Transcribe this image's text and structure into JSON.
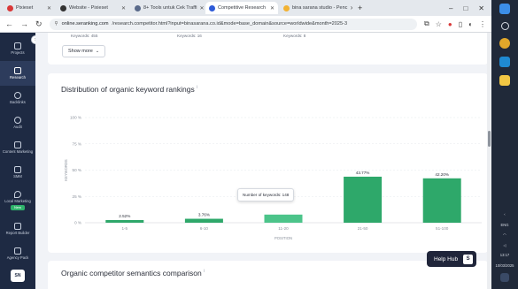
{
  "browser": {
    "tabs": [
      {
        "label": "Pixieset",
        "color": "#d93838",
        "active": false
      },
      {
        "label": "Website - Pixieset",
        "color": "#333333",
        "active": false
      },
      {
        "label": "8+ Tools untuk Cek Traffi",
        "color": "#5a6a8a",
        "active": false
      },
      {
        "label": "Competitive Research",
        "color": "#2e5bd8",
        "active": true
      },
      {
        "label": "bina sarana studio - Penc",
        "color": "#f2b233",
        "active": false
      }
    ],
    "new_tab": "+",
    "window_controls": {
      "minimize": "–",
      "maximize": "□",
      "close": "✕"
    },
    "url_host": "online.seranking.com",
    "url_path": "/research.competitor.html?input=binasarana.co.id&mode=base_domain&source=worldwide&month=2025-3"
  },
  "leftnav": {
    "items": [
      {
        "label": "Projects",
        "active": false
      },
      {
        "label": "Research",
        "active": true
      },
      {
        "label": "Backlinks",
        "active": false
      },
      {
        "label": "Audit",
        "active": false
      },
      {
        "label": "Content Marketing",
        "active": false
      },
      {
        "label": "SMM",
        "active": false
      },
      {
        "label": "Local Marketing",
        "active": false,
        "badge": "New"
      },
      {
        "label": "Report Builder",
        "active": false
      },
      {
        "label": "Agency Pack",
        "active": false
      }
    ],
    "user_initials": "SN"
  },
  "top_card": {
    "keywords": [
      "Keywords: 455",
      "Keywords: 16",
      "Keywords: 8"
    ],
    "show_more": "Show more"
  },
  "chart_card": {
    "title": "Distribution of organic keyword rankings",
    "info_mark": "i"
  },
  "tooltip": {
    "text": "Number of keywords: 148"
  },
  "bottom_card": {
    "title": "Organic competitor semantics comparison",
    "info_mark": "i"
  },
  "help_hub": {
    "label": "Help Hub"
  },
  "taskbar": {
    "time": "13:17",
    "date": "10/03/2025",
    "lang": "ENG"
  },
  "chart_data": {
    "type": "bar",
    "categories": [
      "1-5",
      "6-10",
      "11-20",
      "21-50",
      "51-100"
    ],
    "values": [
      2.52,
      3.76,
      7.73,
      43.77,
      42.2
    ],
    "labels": [
      "2.52%",
      "3.76%",
      "",
      "43.77%",
      "42.20%"
    ],
    "highlight_index": 2,
    "xlabel": "POSITION",
    "ylabel": "KEYWORDS",
    "yticks": [
      "0 %",
      "25 %",
      "50 %",
      "75 %",
      "100 %"
    ],
    "ylim": [
      0,
      100
    ],
    "bar_color": "#2ea86a",
    "highlight_color": "#4cc48a",
    "grid": true
  }
}
